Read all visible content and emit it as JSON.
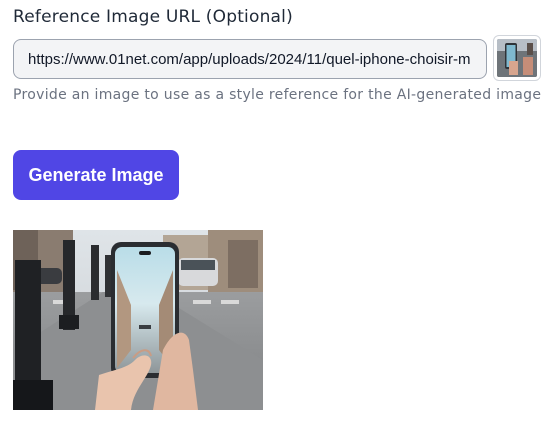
{
  "form": {
    "label": "Reference Image URL (Optional)",
    "url_value": "https://www.01net.com/app/uploads/2024/11/quel-iphone-choisir-m",
    "helper_text": "Provide an image to use as a style reference for the AI-generated image",
    "thumbnail_icon": "reference-thumbnail-image"
  },
  "actions": {
    "generate_label": "Generate Image",
    "accent_color": "#5046e5"
  },
  "result": {
    "image": "generated-image"
  }
}
